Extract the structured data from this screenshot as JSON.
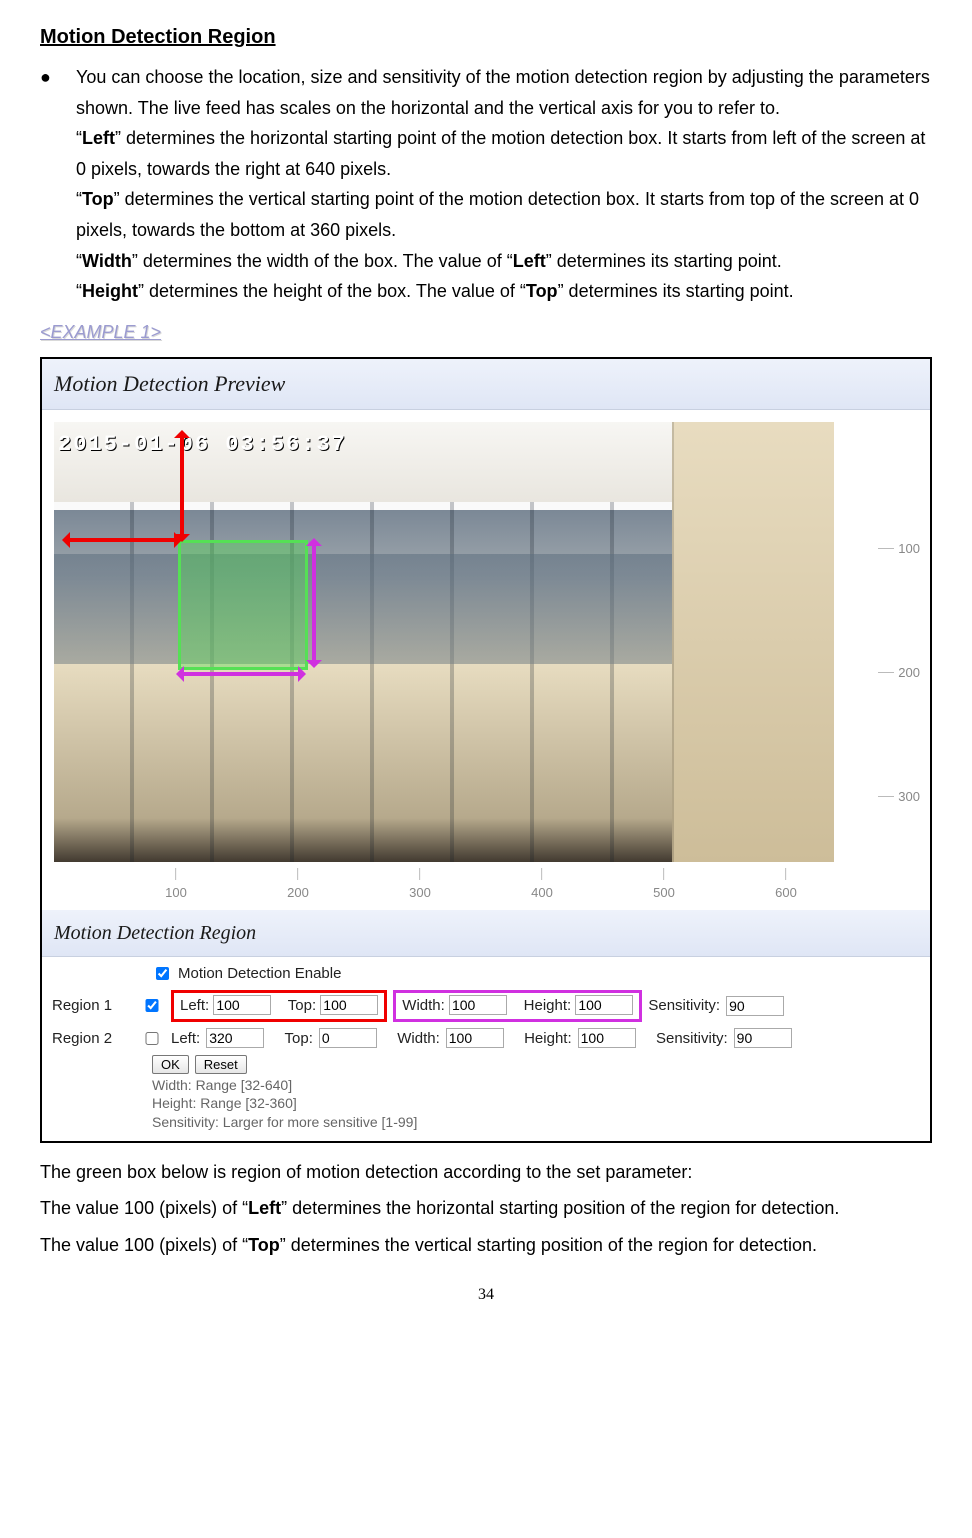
{
  "section_title": "Motion Detection Region",
  "bullet_marker": "●",
  "intro": "You can choose the location, size and sensitivity of the motion detection region by adjusting the parameters shown. The live feed has scales on the horizontal and the vertical axis for you to refer to.",
  "left_pre": "“",
  "left_bold": "Left",
  "left_post": "” determines the horizontal starting point of the motion detection box. It starts from left of the screen at 0 pixels, towards the right at 640 pixels.",
  "top_pre": "“",
  "top_bold": "Top",
  "top_post": "” determines the vertical starting point of the motion detection box. It starts from top of the screen at 0 pixels, towards the bottom at 360 pixels.",
  "width_pre": "“",
  "width_bold": "Width",
  "width_post_a": "” determines the width of the box. The value of “",
  "width_post_bold": "Left",
  "width_post_b": "” determines its starting point.",
  "height_pre": "“",
  "height_bold": "Height",
  "height_post_a": "” determines the height of the box. The value of “",
  "height_post_bold": "Top",
  "height_post_b": "” determines its starting point.",
  "example_label": "<EXAMPLE 1>",
  "preview_header": "Motion Detection Preview",
  "timestamp": "2015-01-06  03:56:37",
  "v_ticks": [
    "100",
    "200",
    "300"
  ],
  "h_ticks": [
    "100",
    "200",
    "300",
    "400",
    "500",
    "600"
  ],
  "region_header": "Motion Detection Region",
  "enable_label": "Motion Detection Enable",
  "labels": {
    "region1": "Region 1",
    "region2": "Region 2",
    "left": "Left:",
    "top": "Top:",
    "width": "Width:",
    "height": "Height:",
    "sens": "Sensitivity:"
  },
  "region1": {
    "enabled": true,
    "left": "100",
    "top": "100",
    "width": "100",
    "height": "100",
    "sens": "90"
  },
  "region2": {
    "enabled": false,
    "left": "320",
    "top": "0",
    "width": "100",
    "height": "100",
    "sens": "90"
  },
  "buttons": {
    "ok": "OK",
    "reset": "Reset"
  },
  "hints": {
    "w": "Width: Range [32-640]",
    "h": "Height: Range [32-360]",
    "s": "Sensitivity: Larger for more sensitive [1-99]"
  },
  "after_p1": "The green box below is region of motion detection according to the set parameter:",
  "after_p2_a": "The value 100 (pixels) of “",
  "after_p2_bold": "Left",
  "after_p2_b": "” determines the horizontal starting position of the region for detection.",
  "after_p3_a": "The value 100 (pixels) of “",
  "after_p3_bold": "Top",
  "after_p3_b": "” determines the vertical starting position of the region for detection.",
  "page_num": "34"
}
